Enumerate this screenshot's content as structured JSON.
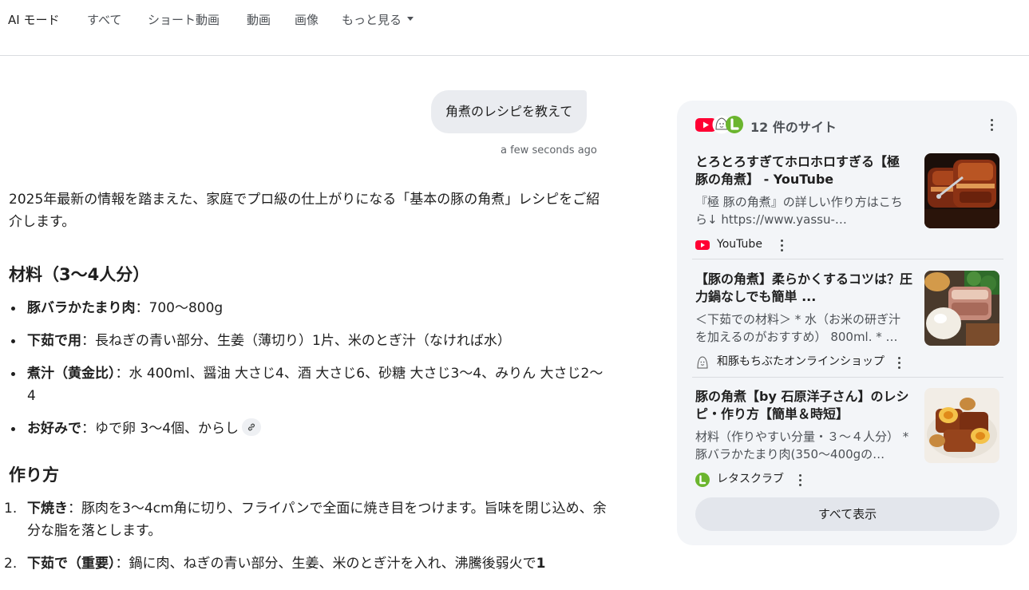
{
  "nav": {
    "tabs": [
      "AI モード",
      "すべて",
      "ショート動画",
      "動画",
      "画像",
      "もっと見る"
    ]
  },
  "query": {
    "text": "角煮のレシピを教えて",
    "timestamp": "a few seconds ago"
  },
  "answer": {
    "intro": "2025年最新の情報を踏まえた、家庭でプロ級の仕上がりになる「基本の豚の角煮」レシピをご紹介します。",
    "ingredients_heading": "材料（3〜4人分）",
    "ingredients": [
      {
        "label": "豚バラかたまり肉",
        "text": "：700〜800g"
      },
      {
        "label": "下茹で用",
        "text": "：長ねぎの青い部分、生姜（薄切り）1片、米のとぎ汁（なければ水）"
      },
      {
        "label": "煮汁（黄金比）",
        "text": "：水 400ml、醤油 大さじ4、酒 大さじ6、砂糖 大さじ3〜4、みりん 大さじ2〜4"
      },
      {
        "label": "お好みで",
        "text": "：ゆで卵 3〜4個、からし"
      }
    ],
    "steps_heading": "作り方",
    "steps": [
      {
        "num": "1.",
        "label": "下焼き",
        "text": "：豚肉を3〜4cm角に切り、フライパンで全面に焼き目をつけます。旨味を閉じ込め、余分な脂を落とします。",
        "tail": ""
      },
      {
        "num": "2.",
        "label": "下茹で（重要）",
        "text": "：鍋に肉、ねぎの青い部分、生姜、米のとぎ汁を入れ、沸騰後弱火で",
        "tail": "1"
      }
    ]
  },
  "sources": {
    "title": "12 件のサイト",
    "cards": [
      {
        "title": "とろとろすぎてホロホロすぎる【極 豚の角煮】 - YouTube",
        "snippet": "『極 豚の角煮』の詳しい作り方はこちら↓ https://www.yassu-…",
        "source": "YouTube",
        "icon": "youtube-icon"
      },
      {
        "title": "【豚の角煮】柔らかくするコツは？圧力鍋なしでも簡単 ...",
        "snippet": "＜下茹での材料＞ * 水（お米の研ぎ汁を加えるのがおすすめ） 800ml. * …",
        "source": "和豚もちぶたオンラインショップ",
        "icon": "mochibuta-icon"
      },
      {
        "title": "豚の角煮【by 石原洋子さん】のレシピ・作り方【簡単＆時短】",
        "snippet": "材料（作りやすい分量・３～４人分） * 豚バラかたまり肉(350〜400gの…",
        "source": "レタスクラブ",
        "icon": "lettuceclub-icon"
      }
    ],
    "show_all": "すべて表示"
  },
  "colors": {
    "panel_bg": "#f3f5f8",
    "bubble_bg": "#eaecf0",
    "youtube_red": "#ff0033",
    "lettuce_green": "#6bb52e"
  }
}
